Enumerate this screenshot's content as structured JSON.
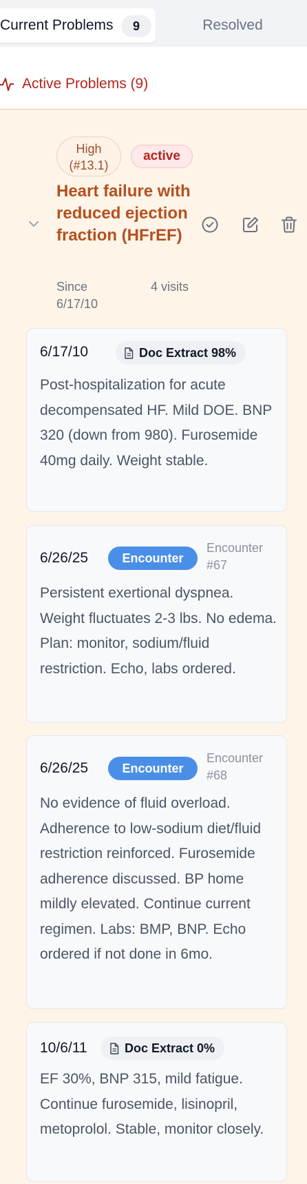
{
  "tabs": {
    "current_label": "Current Problems",
    "current_count": "9",
    "resolved_label": "Resolved"
  },
  "section": {
    "title": "Active Problems (9)",
    "icon": "activity-icon"
  },
  "problem": {
    "priority_badge": "High (#13.1)",
    "status_badge": "active",
    "title": "Heart failure with reduced ejection fraction (HFrEF)",
    "since": "Since 6/17/10",
    "visits": "4 visits",
    "actions": [
      "check-circle-icon",
      "edit-icon",
      "trash-icon"
    ]
  },
  "entries": [
    {
      "date": "6/17/10",
      "source": "Doc Extract 98%",
      "text": "Post-hospitalization for acute decompensated HF. Mild DOE. BNP 320 (down from 980). Furosemide 40mg daily. Weight stable."
    },
    {
      "date": "6/26/25",
      "source": "Encounter",
      "ref": "Encounter #67",
      "text": "Persistent exertional dyspnea. Weight fluctuates 2-3 lbs. No edema. Plan: monitor, sodium/fluid restriction. Echo, labs ordered."
    },
    {
      "date": "6/26/25",
      "source": "Encounter",
      "ref": "Encounter #68",
      "text": "No evidence of fluid overload. Adherence to low-sodium diet/fluid restriction reinforced. Furosemide adherence discussed. BP home mildly elevated. Continue current regimen. Labs: BMP, BNP. Echo ordered if not done in 6mo."
    },
    {
      "date": "10/6/11",
      "source": "Doc Extract 0%",
      "text": "EF 30%, BNP 315, mild fatigue. Continue furosemide, lisinopril, metoprolol. Stable, monitor closely."
    }
  ],
  "colors": {
    "accent_red": "#b3261e",
    "title_orange": "#b5501f",
    "card_bg": "#fef4e8",
    "encounter_blue": "#4a8fe7"
  }
}
